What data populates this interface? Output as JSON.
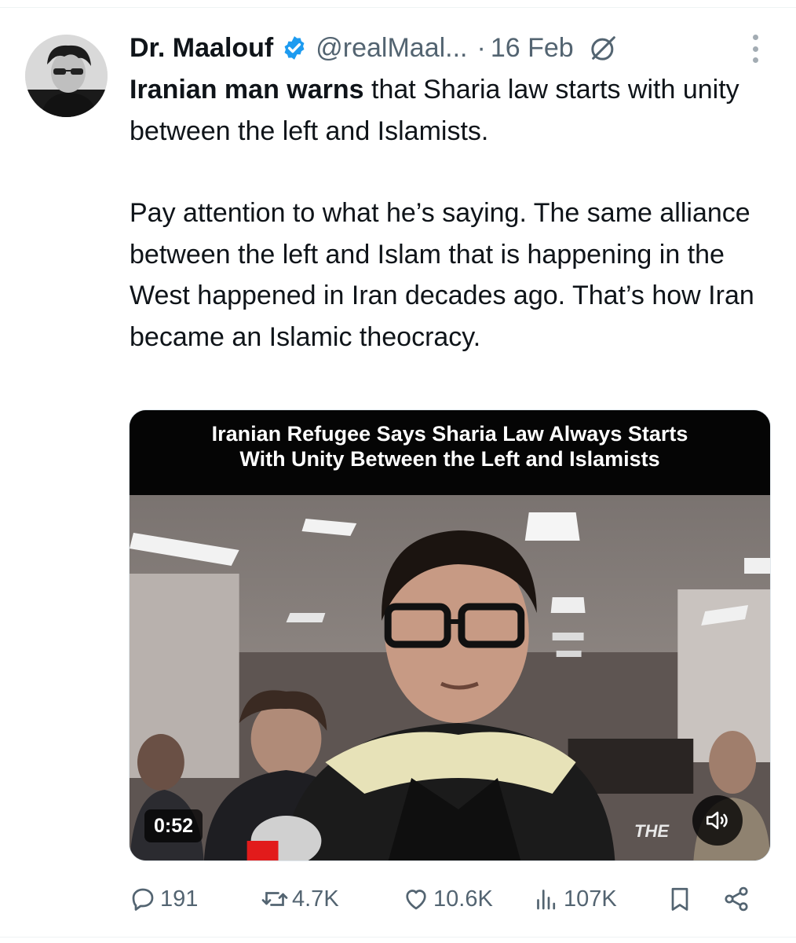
{
  "tweet": {
    "author_name": "Dr. Maalouf",
    "handle": "@realMaal...",
    "separator": "·",
    "date": "16 Feb",
    "verified": true,
    "text_lead_bold": "Iranian man warns",
    "text_lead_rest": " that Sharia law starts with unity between the left and Islamists.",
    "text_paragraph": "Pay attention to what he’s saying. The same alliance between the left and Islam that is happening in the West happened in Iran decades ago. That’s how Iran became an Islamic theocracy."
  },
  "media": {
    "banner_line1": "Iranian Refugee Says Sharia Law Always Starts",
    "banner_line2": "With Unity Between the Left and Islamists",
    "duration": "0:52",
    "watermark": "THE"
  },
  "actions": {
    "replies": "191",
    "reposts": "4.7K",
    "likes": "10.6K",
    "views": "107K"
  },
  "colors": {
    "verified_blue": "#1d9bf0",
    "secondary_text": "#536471",
    "primary_text": "#0f1419"
  },
  "icons": {
    "reply": "reply-icon",
    "repost": "repost-icon",
    "like": "heart-icon",
    "views": "views-icon",
    "bookmark": "bookmark-icon",
    "share": "share-icon",
    "grok": "grok-icon",
    "more": "more-icon",
    "mute": "speaker-icon"
  }
}
